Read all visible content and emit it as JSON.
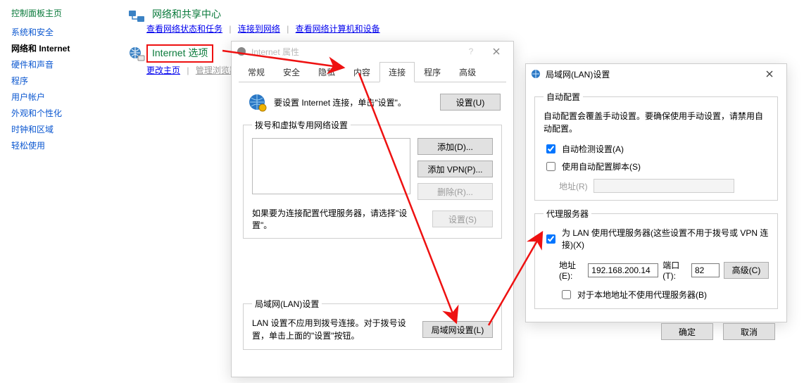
{
  "sidebar": {
    "header": "控制面板主页",
    "items": [
      "系统和安全",
      "网络和 Internet",
      "硬件和声音",
      "程序",
      "用户帐户",
      "外观和个性化",
      "时钟和区域",
      "轻松使用"
    ]
  },
  "cp_main": {
    "section1": {
      "title": "网络和共享中心",
      "links": [
        "查看网络状态和任务",
        "连接到网络",
        "查看网络计算机和设备"
      ]
    },
    "section2": {
      "title": "Internet 选项",
      "links": [
        "更改主页",
        "管理浏览器加载项"
      ]
    }
  },
  "internet_props": {
    "title": "Internet 属性",
    "tabs": [
      "常规",
      "安全",
      "隐私",
      "内容",
      "连接",
      "程序",
      "高级"
    ],
    "setup_text": "要设置 Internet 连接，单击\"设置\"。",
    "setup_btn": "设置(U)",
    "dialup_legend": "拨号和虚拟专用网络设置",
    "add_btn": "添加(D)...",
    "add_vpn_btn": "添加 VPN(P)...",
    "remove_btn": "删除(R)...",
    "proxy_note": "如果要为连接配置代理服务器，请选择\"设置\"。",
    "settings_btn": "设置(S)",
    "lan_legend": "局域网(LAN)设置",
    "lan_note": "LAN 设置不应用到拨号连接。对于拨号设置，单击上面的\"设置\"按钮。",
    "lan_btn": "局域网设置(L)"
  },
  "lan_dialog": {
    "title": "局域网(LAN)设置",
    "auto_legend": "自动配置",
    "auto_note": "自动配置会覆盖手动设置。要确保使用手动设置，请禁用自动配置。",
    "auto_detect": "自动检测设置(A)",
    "use_script": "使用自动配置脚本(S)",
    "addr_label": "地址(R)",
    "proxy_legend": "代理服务器",
    "use_proxy": "为 LAN 使用代理服务器(这些设置不用于拨号或 VPN 连接)(X)",
    "addr_e": "地址(E):",
    "addr_val": "192.168.200.14",
    "port_t": "端口(T):",
    "port_val": "82",
    "advanced_btn": "高级(C)",
    "bypass_local": "对于本地地址不使用代理服务器(B)",
    "ok": "确定",
    "cancel": "取消"
  }
}
